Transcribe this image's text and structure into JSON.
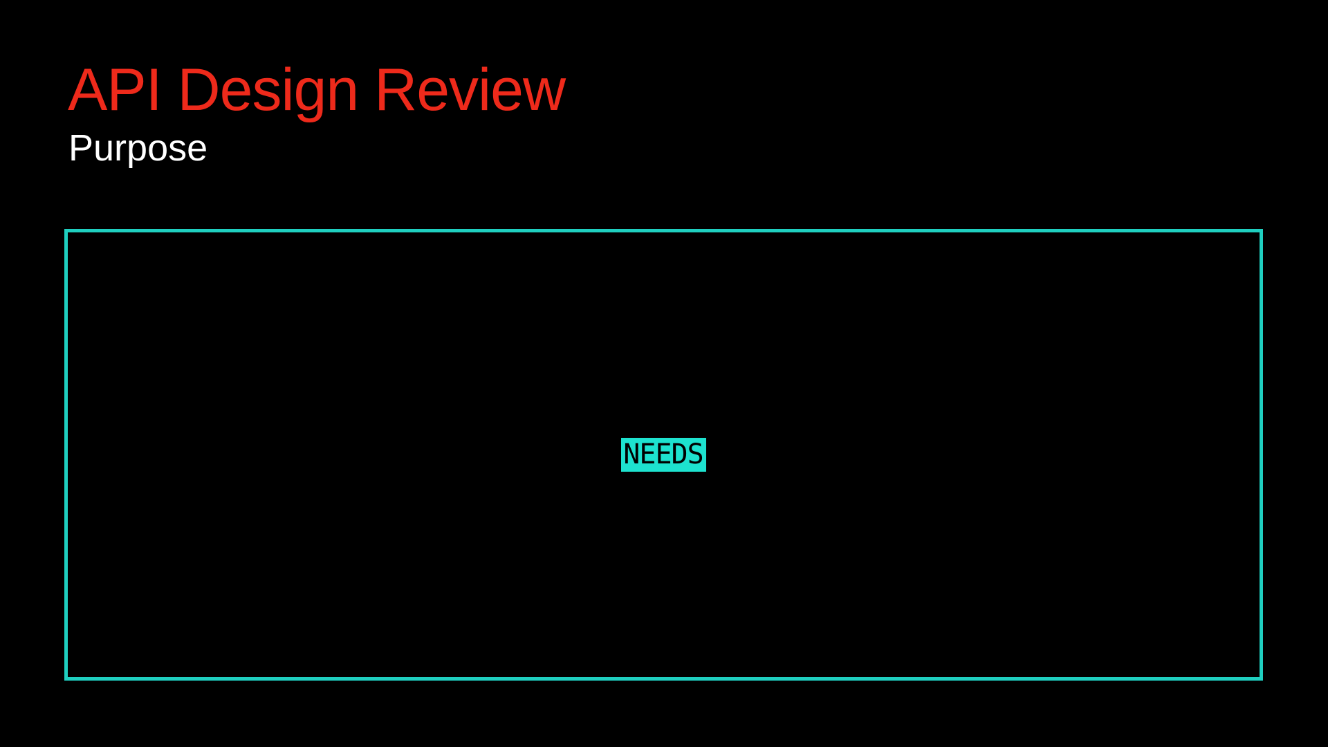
{
  "slide": {
    "title": "API Design Review",
    "subtitle": "Purpose",
    "placeholder_tag": "NEEDS"
  },
  "colors": {
    "background": "#000000",
    "title": "#ee2a1b",
    "subtitle": "#ffffff",
    "frame_border": "#1fcfc0",
    "tag_background": "#1de2cf",
    "tag_text": "#000000"
  }
}
